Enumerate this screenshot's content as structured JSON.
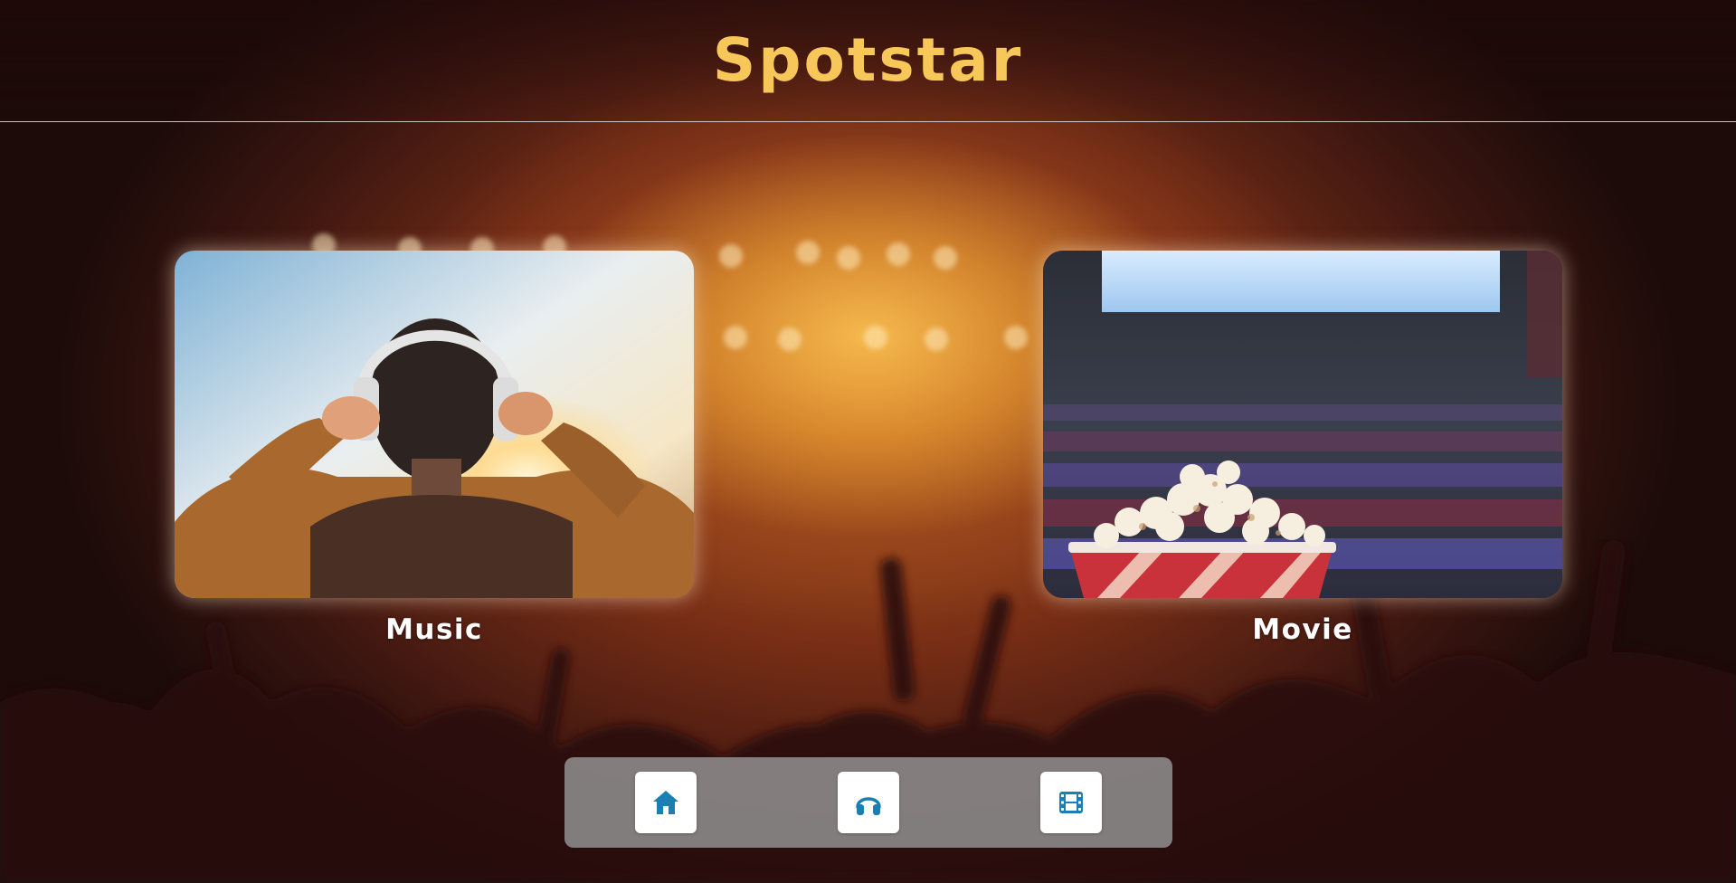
{
  "app": {
    "title": "Spotstar"
  },
  "categories": [
    {
      "label": "Music",
      "image": "person-wearing-headphones-at-sunset"
    },
    {
      "label": "Movie",
      "image": "popcorn-in-cinema-hall"
    }
  ],
  "nav": {
    "items": [
      {
        "name": "home",
        "icon": "home-icon"
      },
      {
        "name": "music",
        "icon": "headphones-icon"
      },
      {
        "name": "movie",
        "icon": "film-icon"
      }
    ]
  },
  "colors": {
    "title": "#f8c75a",
    "accent": "#1a7fb3",
    "nav_background": "#969696",
    "card_label": "#ffffff"
  }
}
